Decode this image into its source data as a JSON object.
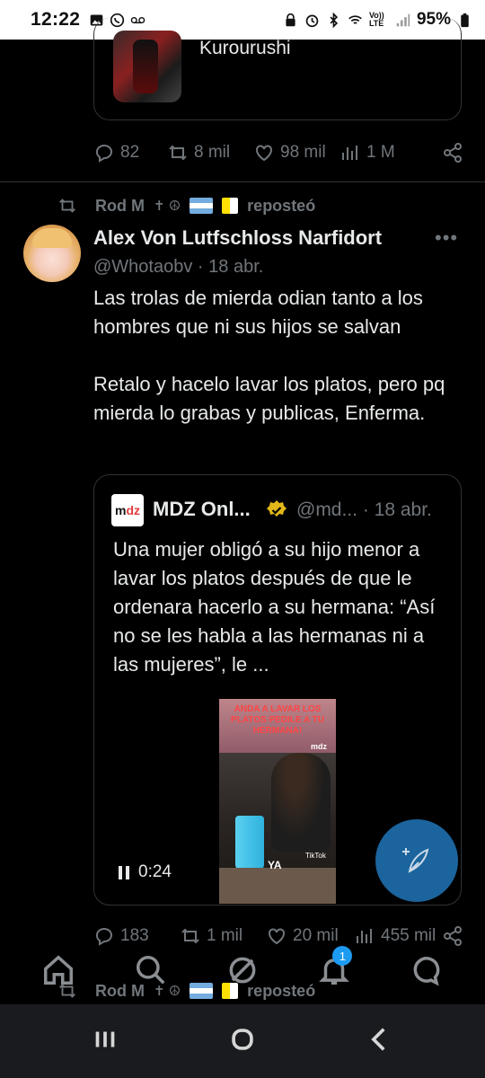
{
  "status_bar": {
    "time": "12:22",
    "battery": "95%",
    "network": "Vo)) LTE"
  },
  "top_card": {
    "name": "Kurourushi"
  },
  "tweet1_actions": {
    "replies": "82",
    "reposts": "8 mil",
    "likes": "98 mil",
    "views": "1 M"
  },
  "repost_header": {
    "user": "Rod M",
    "symbols": "✝︎ ☮︎",
    "label": "reposteó"
  },
  "tweet": {
    "author_name": "Alex Von Lutfschloss Narfidort",
    "handle": "@Whotaobv",
    "date": "· 18 abr.",
    "more": "•••",
    "text": "Las trolas de mierda odian tanto a los hombres que ni sus hijos se salvan\n\nRetalo y hacelo lavar los platos, pero pq mierda lo grabas y publicas, Enferma."
  },
  "quote": {
    "logo_text_a": "m",
    "logo_text_b": "dz",
    "name": "MDZ Onl...",
    "handle": "@md... · 18 abr.",
    "text": "Una mujer obligó a su hijo menor a lavar los platos después de que le ordenara hacerlo a su hermana: “Así no se les habla a las hermanas ni a las mujeres”, le ...",
    "video_overlay": "ANDA A LAVAR LOS PLATOS PEDILE A TU HERMANA!",
    "video_mdz": "mdz",
    "video_caption": "YA",
    "video_tiktok": "TikTok",
    "video_time": "0:24"
  },
  "tweet2_actions": {
    "replies": "183",
    "reposts": "1 mil",
    "likes": "20 mil",
    "views": "455 mil"
  },
  "repost_header_2": {
    "user": "Rod M",
    "symbols": "✝︎ ☮︎",
    "label": "reposteó"
  },
  "bottom_nav": {
    "notifications_badge": "1"
  },
  "colors": {
    "background": "#000000",
    "text": "#e7e9ea",
    "muted": "#71767b",
    "accent": "#1d9bf0",
    "fab": "#1d6aa6"
  }
}
